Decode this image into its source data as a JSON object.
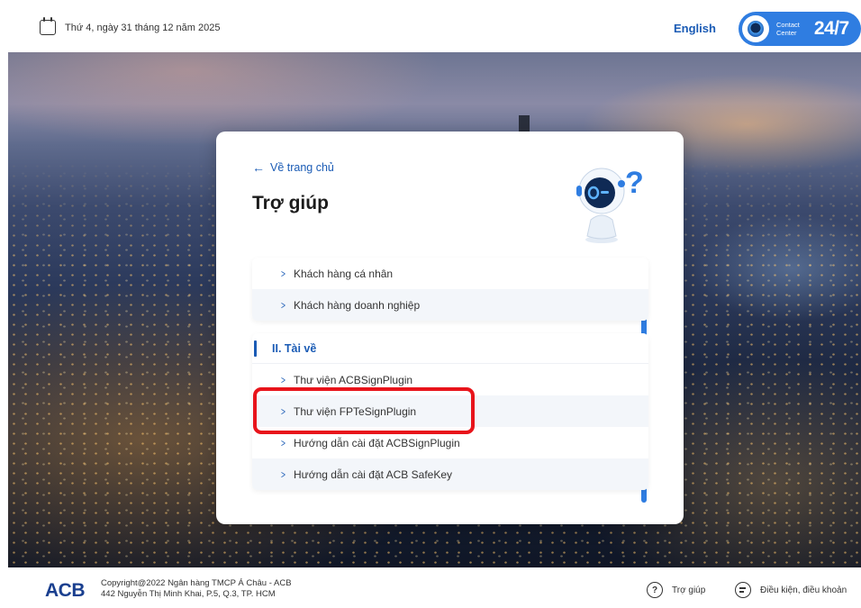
{
  "header": {
    "date": "Thứ 4, ngày 31 tháng 12 năm 2025",
    "language_link": "English",
    "contact_center": {
      "line1": "Contact",
      "line2": "Center",
      "hours": "24/7"
    }
  },
  "help_card": {
    "back_link": "Về trang chủ",
    "title": "Trợ giúp",
    "group_customers": [
      {
        "label": "Khách hàng cá nhân"
      },
      {
        "label": "Khách hàng doanh nghiệp"
      }
    ],
    "section_downloads": {
      "title": "II. Tài về",
      "items": [
        {
          "label": "Thư viện ACBSignPlugin"
        },
        {
          "label": "Thư viện FPTeSignPlugin"
        },
        {
          "label": "Hướng dẫn cài đặt ACBSignPlugin"
        },
        {
          "label": "Hướng dẫn cài đặt ACB SafeKey"
        }
      ]
    }
  },
  "highlighted_item": "Thư viện FPTeSignPlugin",
  "footer": {
    "logo": "ACB",
    "copyright_line1": "Copyright@2022 Ngân hàng TMCP Á Châu - ACB",
    "copyright_line2": "442 Nguyễn Thị Minh Khai, P.5, Q.3, TP. HCM",
    "help_link": "Trợ giúp",
    "terms_link": "Điều kiện, điều khoản"
  },
  "icons": {
    "calendar": "calendar-icon",
    "back": "arrow-left-icon",
    "chevron": "chevron-right-icon",
    "help": "question-circle-icon",
    "terms": "document-circle-icon"
  },
  "colors": {
    "primary": "#1a5bb5",
    "contact_bg": "#2f7de1",
    "highlight": "#e8141b",
    "logo": "#1a3f8f"
  }
}
